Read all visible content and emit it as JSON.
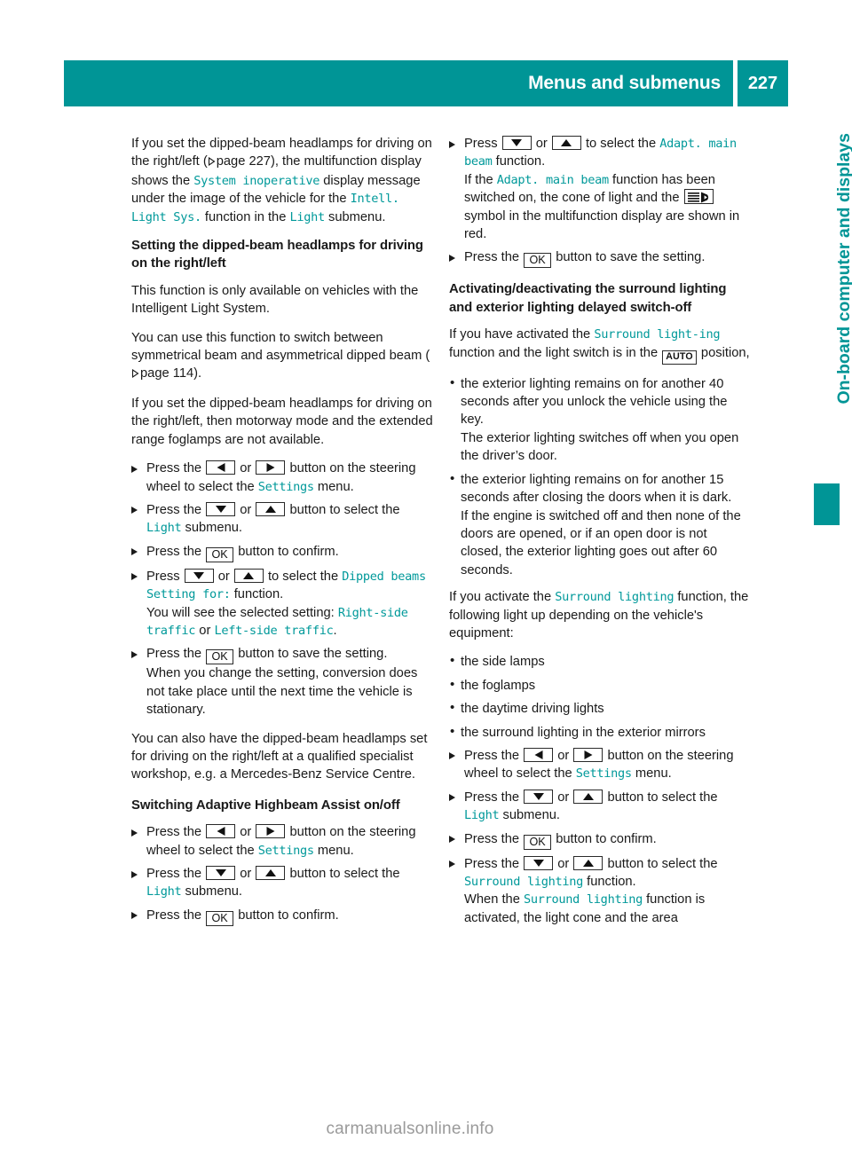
{
  "header": {
    "title": "Menus and submenus",
    "page_number": "227"
  },
  "side": {
    "chapter_label": "On-board computer and displays"
  },
  "footer": {
    "watermark": "carmanualsonline.info"
  },
  "icons": {
    "left_button": "arrow-left-button-icon",
    "right_button": "arrow-right-button-icon",
    "down_button": "arrow-down-button-icon",
    "up_button": "arrow-up-button-icon",
    "ok_button": "OK",
    "auto_switch": "AUTO",
    "headlamp_symbol": "adaptive-main-beam-icon",
    "page_reference": "page-reference-triangle-icon"
  },
  "left_column": {
    "intro": {
      "t1": "If you set the dipped-beam headlamps for driving on the right/left (",
      "t2": "page 227), the multifunction display shows the ",
      "m1": "System inoperative",
      "t3": " display message under the image of the vehicle for the ",
      "m2": "Intell. Light Sys.",
      "t4": " function in the ",
      "m3": "Light",
      "t5": " submenu."
    },
    "heading_1": "Setting the dipped-beam headlamps for driving on the right/left",
    "p1": "This function is only available on vehicles with the Intelligent Light System.",
    "p2_a": "You can use this function to switch between symmetrical beam and asymmetrical dipped beam (",
    "p2_b": "page 114).",
    "p3": "If you set the dipped-beam headlamps for driving on the right/left, then motorway mode and the extended range foglamps are not available.",
    "step1": {
      "a": "Press the ",
      "b": " or ",
      "c": " button on the steering wheel to select the ",
      "m": "Settings",
      "d": " menu."
    },
    "step2": {
      "a": "Press the ",
      "b": " or ",
      "c": " button to select the ",
      "m": "Light",
      "d": " submenu."
    },
    "step3": {
      "a": "Press the ",
      "b": " button to confirm."
    },
    "step4": {
      "a": "Press ",
      "b": " or ",
      "c": " to select the ",
      "m1": "Dipped beams Setting for:",
      "d": " function.",
      "sub_a": "You will see the selected setting: ",
      "m2": "Right-side traffic",
      "sub_b": " or ",
      "m3": "Left-side traffic",
      "sub_c": "."
    },
    "step5": {
      "a": "Press the ",
      "b": " button to save the setting.",
      "sub": "When you change the setting, conversion does not take place until the next time the vehicle is stationary."
    },
    "p4": "You can also have the dipped-beam headlamps set for driving on the right/left at a qualified specialist workshop, e.g. a Mercedes-Benz Service Centre.",
    "heading_2": "Switching Adaptive Highbeam Assist on/off",
    "step6": {
      "a": "Press the ",
      "b": " or ",
      "c": " button on the steering wheel to select the ",
      "m": "Settings",
      "d": " menu."
    },
    "step7": {
      "a": "Press the ",
      "b": " or ",
      "c": " button to select the ",
      "m": "Light",
      "d": " submenu."
    },
    "step8": {
      "a": "Press the ",
      "b": " button to confirm."
    }
  },
  "right_column": {
    "step1": {
      "a": "Press ",
      "b": " or ",
      "c": " to select the ",
      "m1": "Adapt. main beam",
      "d": " function.",
      "sub_a": "If the ",
      "m2": "Adapt. main beam",
      "sub_b": " function has been switched on, the cone of light and the ",
      "sub_c": " symbol in the multifunction display are shown in red."
    },
    "step2": {
      "a": "Press the ",
      "b": " button to save the setting."
    },
    "heading_1": "Activating/deactivating the surround lighting and exterior lighting delayed switch-off",
    "p1_a": "If you have activated the ",
    "p1_m": "Surround light-ing",
    "p1_b": " function and the light switch is in the ",
    "p1_c": " position,",
    "bullet1": {
      "a": "the exterior lighting remains on for another 40 seconds after you unlock the vehicle using the key.",
      "sub": "The exterior lighting switches off when you open the driver’s door."
    },
    "bullet2": {
      "a": "the exterior lighting remains on for another 15 seconds after closing the doors when it is dark.",
      "sub": "If the engine is switched off and then none of the doors are opened, or if an open door is not closed, the exterior lighting goes out after 60 seconds."
    },
    "p2_a": "If you activate the ",
    "p2_m": "Surround lighting",
    "p2_b": " function, the following light up depending on the vehicle's equipment:",
    "bullet3": "the side lamps",
    "bullet4": "the foglamps",
    "bullet5": "the daytime driving lights",
    "bullet6": "the surround lighting in the exterior mirrors",
    "step3": {
      "a": "Press the ",
      "b": " or ",
      "c": " button on the steering wheel to select the ",
      "m": "Settings",
      "d": " menu."
    },
    "step4": {
      "a": "Press the ",
      "b": " or ",
      "c": " button to select the ",
      "m": "Light",
      "d": " submenu."
    },
    "step5": {
      "a": "Press the ",
      "b": " button to confirm."
    },
    "step6": {
      "a": "Press the ",
      "b": " or ",
      "c": " button to select the ",
      "m1": "Surround lighting",
      "d": " function.",
      "sub_a": "When the ",
      "m2": "Surround lighting",
      "sub_b": " function is activated, the light cone and the area"
    }
  }
}
